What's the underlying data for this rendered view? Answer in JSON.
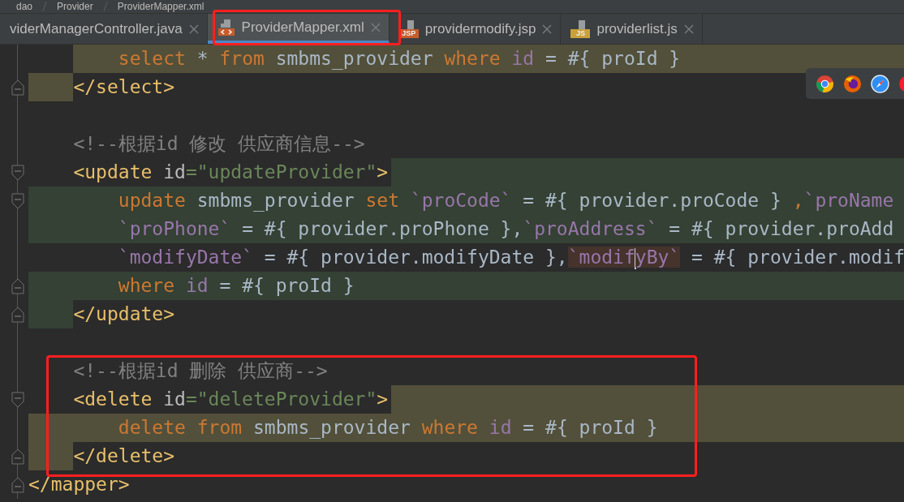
{
  "breadcrumb": [
    "dao",
    "Provider",
    "ProviderMapper.xml"
  ],
  "tabs": [
    {
      "label": "viderManagerController.java",
      "selected": false
    },
    {
      "label": "ProviderMapper.xml",
      "icon": {
        "kind": "markup"
      },
      "selected": true
    },
    {
      "label": "providermodify.jsp",
      "icon": {
        "kind": "badge",
        "label": "JSP",
        "color": "#c75d2c"
      },
      "selected": false
    },
    {
      "label": "providerlist.js",
      "icon": {
        "kind": "badge",
        "label": "JS",
        "color": "#c9a13a"
      },
      "selected": false
    }
  ],
  "lines": [
    {
      "children": [
        {
          "children": [
            {
              "highlight": {
                "kind": "code",
                "color": "#52503a"
              },
              "tokens": [
                {
                  "text": "select",
                  "kind": "kw"
                },
                {
                  "text": " * ",
                  "kind": "plain"
                },
                {
                  "text": "from",
                  "kind": "kw"
                },
                {
                  "text": " smbms_provider ",
                  "kind": "plain"
                },
                {
                  "text": "where",
                  "kind": "kw"
                },
                {
                  "text": " id",
                  "kind": "field"
                },
                {
                  "text": " = #{ proId }",
                  "kind": "plain"
                }
              ]
            }
          ]
        },
        {
          "fold_end": true,
          "highlight": {
            "kind": "margin",
            "color": "#52503a"
          },
          "tokens": [
            {
              "text": "</select>",
              "kind": "tag"
            }
          ]
        },
        {
          "kind": "blank"
        },
        {
          "tokens": [
            {
              "text": "<!--根据id 修改 供应商信息-->",
              "kind": "comment"
            }
          ]
        },
        {
          "fold_start": true,
          "highlight": {
            "kind": "after",
            "color": "#344134"
          },
          "tokens": [
            {
              "text": "<update ",
              "kind": "tag"
            },
            {
              "text": "id",
              "kind": "attr"
            },
            {
              "text": "=\"updateProvider\"",
              "kind": "str"
            },
            {
              "text": ">",
              "kind": "tag"
            }
          ],
          "children": [
            {
              "fold_start": true,
              "highlight": {
                "kind": "full",
                "color": "#344134"
              },
              "tokens": [
                {
                  "text": "update",
                  "kind": "kw"
                },
                {
                  "text": " smbms_provider ",
                  "kind": "plain"
                },
                {
                  "text": "set",
                  "kind": "kw"
                },
                {
                  "text": " `proCode`",
                  "kind": "field"
                },
                {
                  "text": " = #{ provider.proCode } ",
                  "kind": "plain"
                },
                {
                  "text": ",",
                  "kind": "kw"
                },
                {
                  "text": "`proName",
                  "kind": "field"
                }
              ]
            },
            {
              "highlight": {
                "kind": "full",
                "color": "#344134"
              },
              "tokens": [
                {
                  "text": "`proPhone`",
                  "kind": "field"
                },
                {
                  "text": " = #{ provider.proPhone },",
                  "kind": "plain"
                },
                {
                  "text": "`proAddress`",
                  "kind": "field"
                },
                {
                  "text": " = #{ provider.proAdd",
                  "kind": "plain"
                }
              ]
            },
            {
              "tokens": [
                {
                  "text": "`modifyDate`",
                  "kind": "field"
                },
                {
                  "text": " = #{ provider.modifyDate },",
                  "kind": "plain"
                },
                {
                  "text": "`modif",
                  "kind": "field",
                  "found": true
                },
                {
                  "kind": "caret"
                },
                {
                  "text": "yBy`",
                  "kind": "field",
                  "found": true
                },
                {
                  "text": " = #{ provider.modif",
                  "kind": "plain"
                }
              ]
            },
            {
              "fold_end": true,
              "highlight": {
                "kind": "full",
                "color": "#344134"
              },
              "tokens": [
                {
                  "text": "where",
                  "kind": "kw"
                },
                {
                  "text": " id",
                  "kind": "field"
                },
                {
                  "text": " = #{ proId }",
                  "kind": "plain"
                }
              ]
            }
          ]
        },
        {
          "fold_end": true,
          "highlight": {
            "kind": "margin",
            "color": "#344134"
          },
          "tokens": [
            {
              "text": "</update>",
              "kind": "tag"
            }
          ]
        },
        {
          "kind": "blank"
        },
        {
          "tokens": [
            {
              "text": "<!--根据id 删除 供应商-->",
              "kind": "comment"
            }
          ]
        },
        {
          "fold_start": true,
          "highlight": {
            "kind": "after",
            "color": "#52503a"
          },
          "tokens": [
            {
              "text": "<delete ",
              "kind": "tag"
            },
            {
              "text": "id",
              "kind": "attr"
            },
            {
              "text": "=\"deleteProvider\"",
              "kind": "str"
            },
            {
              "text": ">",
              "kind": "tag"
            }
          ],
          "children": [
            {
              "highlight": {
                "kind": "full",
                "color": "#52503a"
              },
              "tokens": [
                {
                  "text": "delete",
                  "kind": "kw"
                },
                {
                  "text": " from",
                  "kind": "kw"
                },
                {
                  "text": " smbms_provider ",
                  "kind": "plain"
                },
                {
                  "text": "where",
                  "kind": "kw"
                },
                {
                  "text": " id",
                  "kind": "field"
                },
                {
                  "text": " = #{ proId }",
                  "kind": "plain"
                }
              ]
            }
          ]
        },
        {
          "fold_end": true,
          "highlight": {
            "kind": "margin",
            "color": "#52503a"
          },
          "tokens": [
            {
              "text": "</delete>",
              "kind": "tag"
            }
          ]
        }
      ]
    },
    {
      "fold_end": true,
      "tokens": [
        {
          "text": "</mapper>",
          "kind": "tag"
        }
      ]
    }
  ]
}
